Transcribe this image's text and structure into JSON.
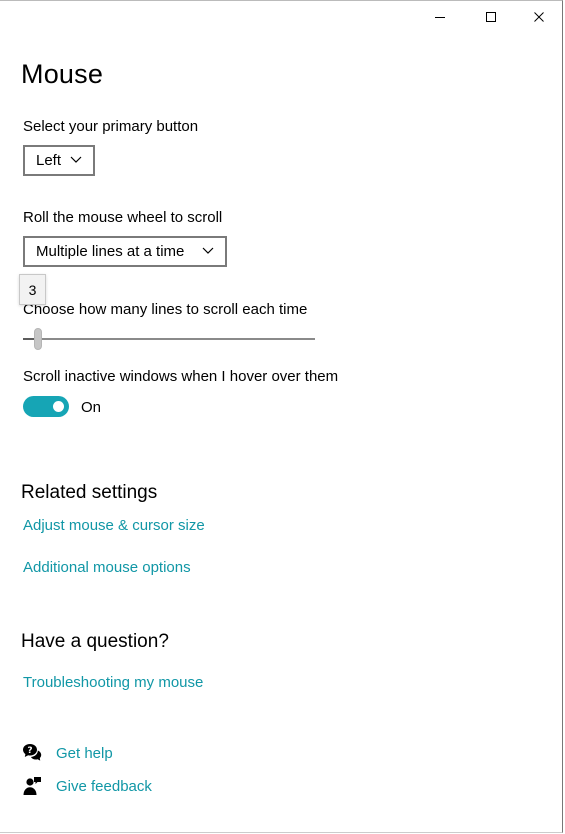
{
  "window": {
    "caption_buttons": [
      "minimize-icon",
      "maximize-icon",
      "close-icon"
    ]
  },
  "page": {
    "title": "Mouse"
  },
  "primary_button": {
    "label": "Select your primary button",
    "selected": "Left"
  },
  "scroll": {
    "label": "Roll the mouse wheel to scroll",
    "selected": "Multiple lines at a time"
  },
  "lines": {
    "tooltip": "3",
    "label": "Choose how many lines to scroll each time",
    "value": 3,
    "min": 1,
    "max": 100
  },
  "inactive": {
    "label": "Scroll inactive windows when I hover over them",
    "state": "On",
    "color": "#16a5b5"
  },
  "related": {
    "title": "Related settings",
    "links": [
      "Adjust mouse & cursor size",
      "Additional mouse options"
    ]
  },
  "question": {
    "title": "Have a question?",
    "link": "Troubleshooting my mouse"
  },
  "help": {
    "get_help": "Get help",
    "give_feedback": "Give feedback",
    "link_color": "#1197a6"
  }
}
